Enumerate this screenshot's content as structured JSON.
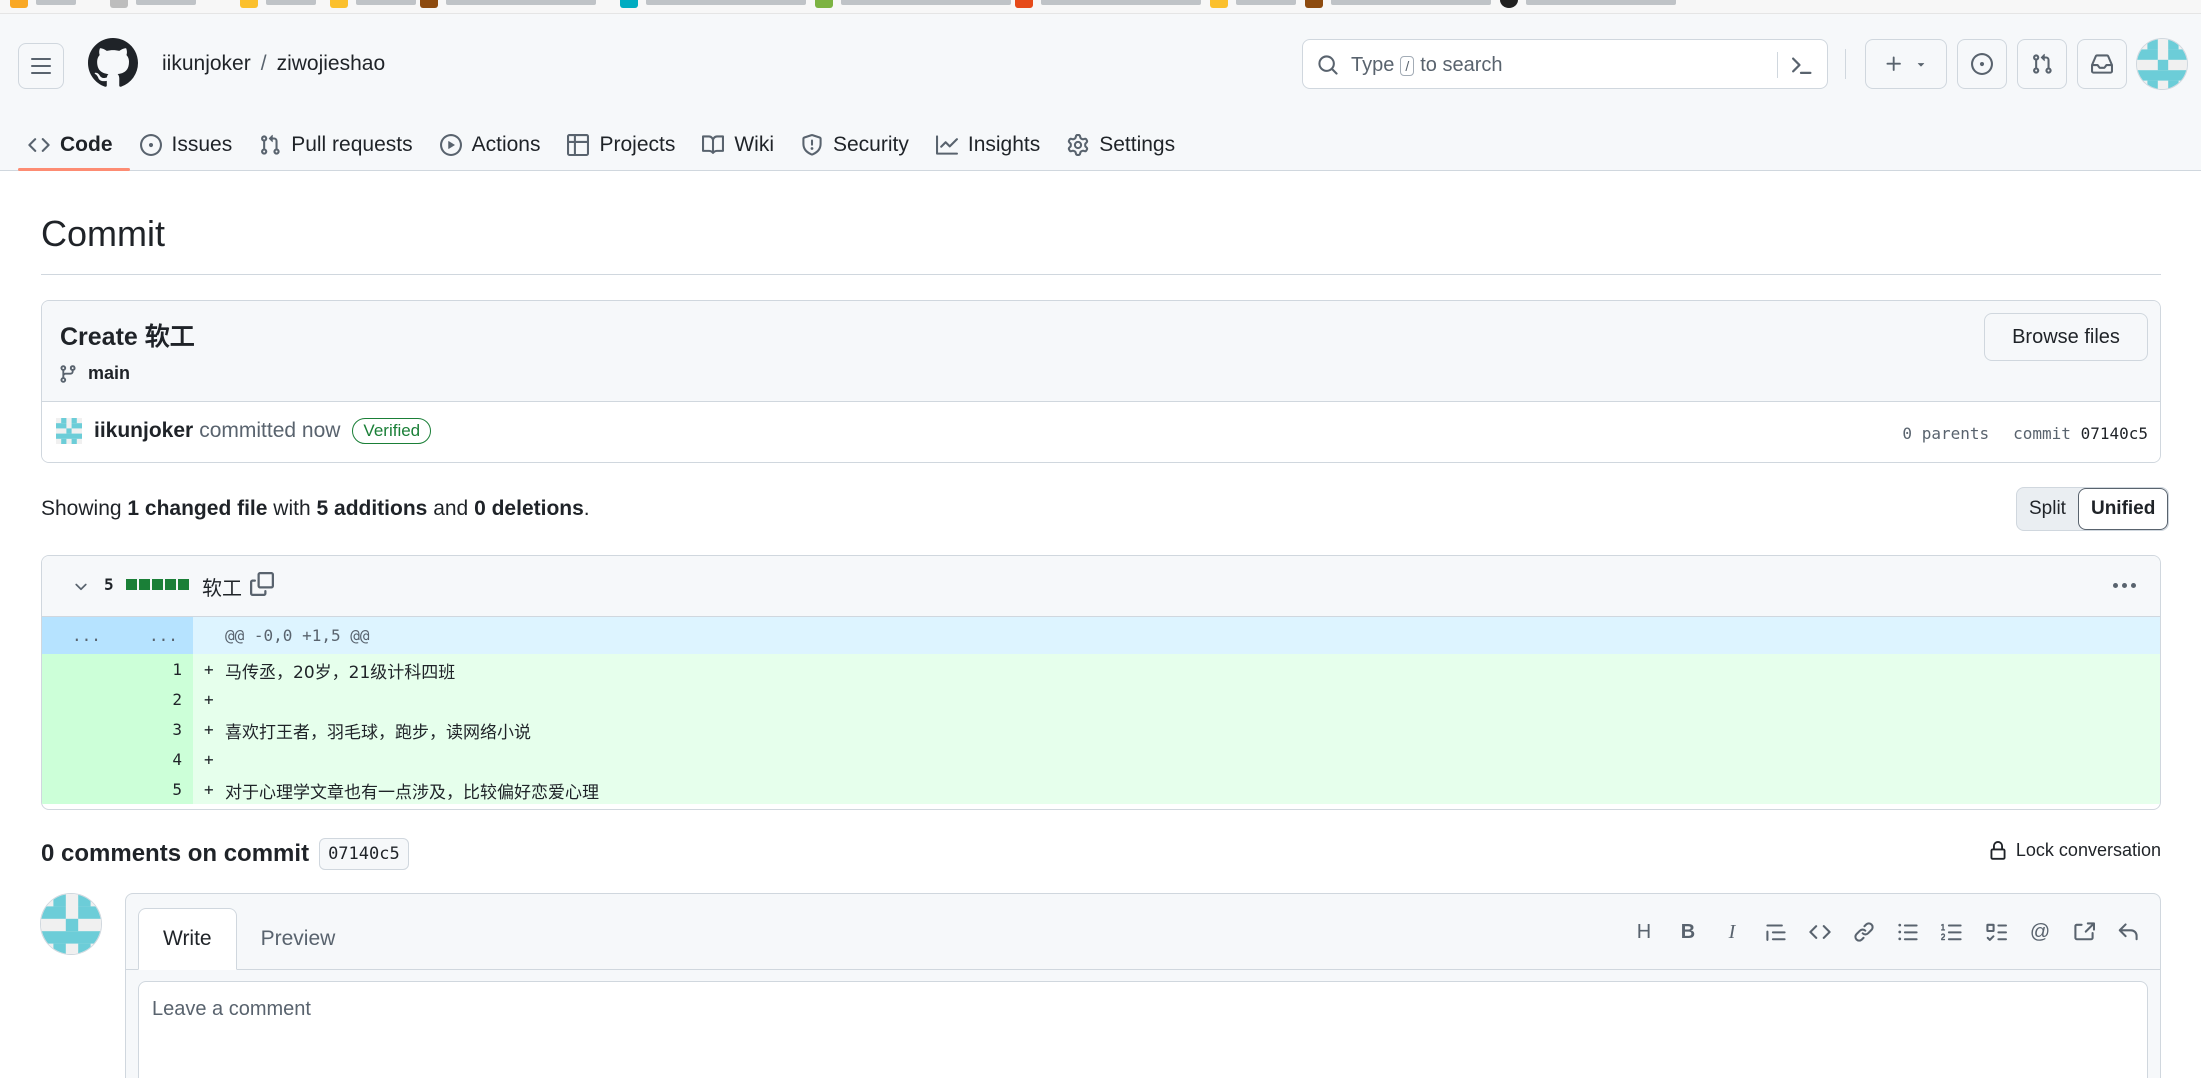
{
  "header": {
    "owner": "iikunjoker",
    "separator": "/",
    "repo": "ziwojieshao",
    "search": {
      "prefix": "Type",
      "key": "/",
      "suffix": "to search"
    }
  },
  "tabs": [
    {
      "label": "Code",
      "icon": "code-icon",
      "active": true
    },
    {
      "label": "Issues",
      "icon": "issue-opened-icon"
    },
    {
      "label": "Pull requests",
      "icon": "git-pull-request-icon"
    },
    {
      "label": "Actions",
      "icon": "play-icon"
    },
    {
      "label": "Projects",
      "icon": "table-icon"
    },
    {
      "label": "Wiki",
      "icon": "book-icon"
    },
    {
      "label": "Security",
      "icon": "shield-icon"
    },
    {
      "label": "Insights",
      "icon": "graph-icon"
    },
    {
      "label": "Settings",
      "icon": "gear-icon"
    }
  ],
  "page": {
    "title": "Commit"
  },
  "commit": {
    "message": "Create 软工",
    "branch": "main",
    "browse_label": "Browse files",
    "author": "iikunjoker",
    "verb": "committed now",
    "verified": "Verified",
    "parents": "0 parents",
    "commit_label": "commit",
    "sha": "07140c5"
  },
  "summary": {
    "showing": "Showing",
    "changed": "1 changed file",
    "with": "with",
    "additions": "5 additions",
    "and": "and",
    "deletions": "0 deletions",
    "period": "."
  },
  "view_toggle": {
    "split": "Split",
    "unified": "Unified",
    "selected": "Unified"
  },
  "diff": {
    "count": "5",
    "filename": "软工",
    "hunk_left": "...",
    "hunk_right": "...",
    "hunk_header": "@@ -0,0 +1,5 @@",
    "lines": [
      {
        "num": "1",
        "sign": "+",
        "text": "马传丞，20岁，21级计科四班"
      },
      {
        "num": "2",
        "sign": "+",
        "text": ""
      },
      {
        "num": "3",
        "sign": "+",
        "text": "喜欢打王者，羽毛球，跑步，读网络小说"
      },
      {
        "num": "4",
        "sign": "+",
        "text": ""
      },
      {
        "num": "5",
        "sign": "+",
        "text": "对于心理学文章也有一点涉及，比较偏好恋爱心理"
      }
    ]
  },
  "comments": {
    "title": "0 comments on commit",
    "sha": "07140c5",
    "lock_label": "Lock conversation",
    "write_tab": "Write",
    "preview_tab": "Preview",
    "placeholder": "Leave a comment",
    "toolbar": [
      "heading-icon",
      "bold-icon",
      "italic-icon",
      "quote-icon",
      "code-icon",
      "link-icon",
      "unordered-list-icon",
      "ordered-list-icon",
      "task-list-icon",
      "mention-icon",
      "cross-reference-icon",
      "reply-icon"
    ]
  },
  "colors": {
    "accent_underline": "#fd8c73",
    "added_bg": "#e6ffec",
    "added_gutter": "#ccffd8",
    "hunk_bg": "#ddf4ff",
    "verified": "#1a7f37"
  }
}
